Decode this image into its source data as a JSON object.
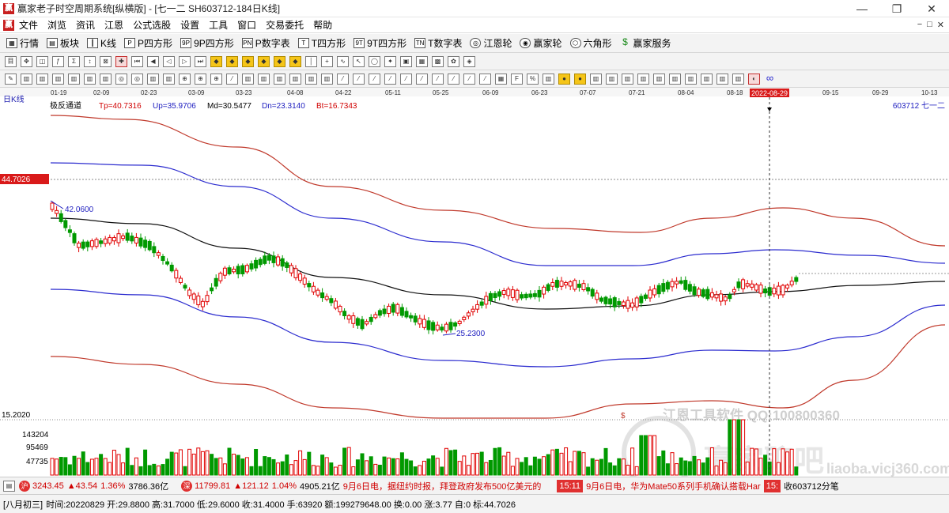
{
  "window": {
    "title": "赢家老子时空周期系统[纵横版] - [七一二  SH603712-184日K线]",
    "controls": [
      "—",
      "❐",
      "✕"
    ]
  },
  "menu": {
    "items": [
      "文件",
      "浏览",
      "资讯",
      "江恩",
      "公式选股",
      "设置",
      "工具",
      "窗口",
      "交易委托",
      "帮助"
    ],
    "right": [
      "−",
      "□",
      "✕"
    ]
  },
  "toolbar1": {
    "items": [
      {
        "label": "行情",
        "icon": "grid-icon"
      },
      {
        "label": "板块",
        "icon": "block-icon"
      },
      {
        "label": "K线",
        "icon": "kline-icon"
      },
      {
        "label": "P四方形",
        "icon": "P"
      },
      {
        "label": "9P四方形",
        "icon": "9P"
      },
      {
        "label": "P数字表",
        "icon": "PN"
      },
      {
        "label": "T四方形",
        "icon": "T"
      },
      {
        "label": "9T四方形",
        "icon": "9T"
      },
      {
        "label": "T数字表",
        "icon": "TN"
      },
      {
        "label": "江恩轮",
        "icon": "wheel-icon"
      },
      {
        "label": "赢家轮",
        "icon": "wheel-icon"
      },
      {
        "label": "六角形",
        "icon": "hexagon-icon"
      },
      {
        "label": "赢家服务",
        "icon": "dollar-icon"
      }
    ]
  },
  "chart": {
    "period_label": "日K线",
    "indicator_name": "极反通道",
    "indicator_values": {
      "Tp": "Tp=40.7316",
      "Up": "Up=35.9706",
      "Md": "Md=30.5477",
      "Dn": "Dn=23.3140",
      "Bt": "Bt=16.7343"
    },
    "stock_code_label": "603712  七一二",
    "date_ticks": [
      "01-19",
      "02-09",
      "02-23",
      "03-09",
      "03-23",
      "04-08",
      "04-22",
      "05-11",
      "05-25",
      "06-09",
      "06-23",
      "07-07",
      "07-21",
      "08-04",
      "08-18",
      "09-15",
      "09-29",
      "10-13"
    ],
    "cursor_date": "2022-08-29",
    "cursor_price_label": "44.7026",
    "high_label": "42.0600",
    "low_label": "25.2300",
    "price_scale_bottom": "15.2020",
    "volume_ticks": [
      "143204",
      "95469",
      "47735"
    ],
    "watermark_text": "江恩工具软件 QQ:100800360",
    "watermark_logo": "赢家聊吧",
    "watermark_url": "liaoba.vicj360.com",
    "dollar_marker": "$"
  },
  "chart_data": {
    "type": "candlestick",
    "x_range": [
      "2022-01-19",
      "2022-10-13"
    ],
    "y_range": [
      15.202,
      44.7026
    ],
    "channels": {
      "Tp": 40.7316,
      "Up": 35.9706,
      "Md": 30.5477,
      "Dn": 23.314,
      "Bt": 16.7343
    },
    "annotations": [
      {
        "label": "42.0600",
        "type": "high"
      },
      {
        "label": "25.2300",
        "type": "low"
      }
    ],
    "last_bar": {
      "date": "2022-08-29",
      "open": 29.88,
      "high": 31.7,
      "low": 29.6,
      "close": 31.4,
      "volume": 63920,
      "amount": 199279648.0
    }
  },
  "status1": {
    "sh": {
      "index": "3243.45",
      "chg": "▲43.54",
      "pct": "1.36%",
      "amt": "3786.36亿"
    },
    "sz": {
      "index": "11799.81",
      "chg": "▲121.12",
      "pct": "1.04%",
      "amt": "4905.21亿"
    },
    "news1": "9月6日电，据纽约时报，拜登政府发布500亿美元的",
    "time1": "15:11",
    "news2": "9月6日电，华为Mate50系列手机确认搭载Har",
    "time2": "15:",
    "right": "收603712分笔"
  },
  "status2": {
    "lunar": "[八月初三]",
    "text": "时间:20220829 开:29.8800 高:31.7000 低:29.6000 收:31.4000 手:63920 额:199279648.00 换:0.00 涨:3.77 自:0 标:44.7026"
  },
  "colors": {
    "up": "#e00000",
    "down": "#009900",
    "tp": "#c0392b",
    "up_band": "#2c2ccf",
    "md": "#111111",
    "dn": "#2c2ccf",
    "bt": "#c0392b",
    "cursor_label_bg": "#d91a1a"
  }
}
